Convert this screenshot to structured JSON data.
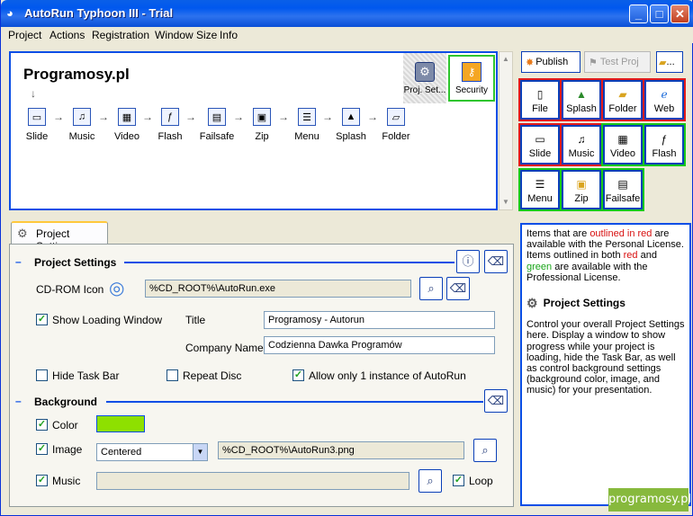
{
  "window": {
    "title": "AutoRun Typhoon III - Trial",
    "min": "_",
    "max": "□",
    "close": "✕"
  },
  "menu": [
    "Project",
    "Actions",
    "Registration",
    "Window Size",
    "Info"
  ],
  "flow": {
    "title": "Programosy.pl",
    "items": [
      "Slide",
      "Music",
      "Video",
      "Flash",
      "Failsafe",
      "Zip",
      "Menu",
      "Splash",
      "Folder"
    ],
    "proj_settings": "Proj. Set...",
    "security": "Security"
  },
  "toolbar": {
    "publish": "Publish",
    "test": "Test Proj",
    "folder_btn": "..."
  },
  "palette": {
    "row1": [
      "File",
      "Splash",
      "Folder",
      "Web"
    ],
    "row2": [
      "Slide",
      "Music",
      "Video",
      "Flash"
    ],
    "row3": [
      "Menu",
      "Zip",
      "Failsafe"
    ]
  },
  "tab": "Project Settings",
  "project_settings": {
    "header": "Project Settings",
    "cdrom_label": "CD-ROM Icon",
    "cdrom_value": "%CD_ROOT%\\AutoRun.exe",
    "show_loading": "Show Loading Window",
    "title_label": "Title",
    "title_value": "Programosy - Autorun",
    "company_label": "Company Name",
    "company_value": "Codzienna Dawka Programów",
    "hide_taskbar": "Hide Task Bar",
    "repeat_disc": "Repeat Disc",
    "allow_one": "Allow only 1 instance of AutoRun"
  },
  "background": {
    "header": "Background",
    "color_label": "Color",
    "color_value": "#8ee000",
    "image_label": "Image",
    "image_mode": "Centered",
    "image_value": "%CD_ROOT%\\AutoRun3.png",
    "music_label": "Music",
    "music_value": "",
    "loop_label": "Loop"
  },
  "info": {
    "p1_a": "Items that are ",
    "p1_red": "outlined in red",
    "p1_b": " are available with the Personal License. Items outlined in both ",
    "p1_red2": "red",
    "p1_c": " and ",
    "p1_green": "green",
    "p1_d": " are available with the Professional License.",
    "heading": "Project Settings",
    "p2": "Control your overall Project Settings here. Display a window to show progress while your project is loading, hide the Task Bar, as well as control background settings (background color, image, and music) for your presentation."
  },
  "watermark": "programosy.pl"
}
